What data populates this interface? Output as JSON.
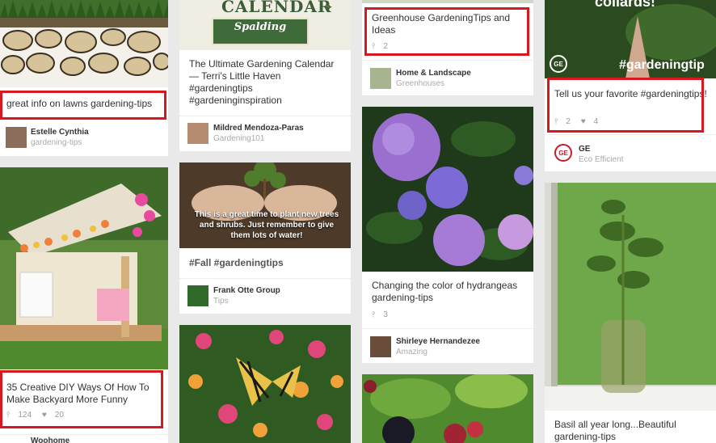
{
  "pins": {
    "lawns": {
      "description": "great info on lawns gardening-tips",
      "pinner": "Estelle Cynthia",
      "board": "gardening-tips"
    },
    "backyard": {
      "description": "35 Creative DIY Ways Of How To Make Backyard More Funny",
      "repins": "124",
      "likes": "20",
      "pinner": "Woohome"
    },
    "calendar": {
      "image_text": "CALENDAR",
      "sponsor_text": "Spalding",
      "description": "The Ultimate Gardening Calendar — Terri's Little Haven #gardeningtips #gardeninginspiration",
      "pinner": "Mildred Mendoza-Paras",
      "board": "Gardening101"
    },
    "fall": {
      "image_text": "This is a great time to plant new trees and shrubs. Just remember to give them lots of water!",
      "description": "#Fall #gardeningtips",
      "pinner": "Frank Otte Group",
      "board": "Tips"
    },
    "greenhouse": {
      "description": "Greenhouse GardeningTips and Ideas",
      "repins": "2",
      "pinner": "Home & Landscape",
      "board": "Greenhouses"
    },
    "hydrangea": {
      "description": "Changing the color of hydrangeas gardening-tips",
      "repins": "3",
      "pinner": "Shirleye Hernandezee",
      "board": "Amazing"
    },
    "collards": {
      "image_text": "collards!",
      "hashtag": "#gardeningtip",
      "description": "Tell us your favorite #gardeningtips!",
      "repins": "2",
      "likes": "4",
      "pinner": "GE",
      "board": "Eco Efficient"
    },
    "basil": {
      "description": "Basil all year long...Beautiful gardening-tips"
    }
  },
  "colors": {
    "highlight": "#d8171f",
    "ge_red": "#c41e2e"
  },
  "icons": {
    "repin": "pin-icon",
    "like": "heart-icon"
  }
}
